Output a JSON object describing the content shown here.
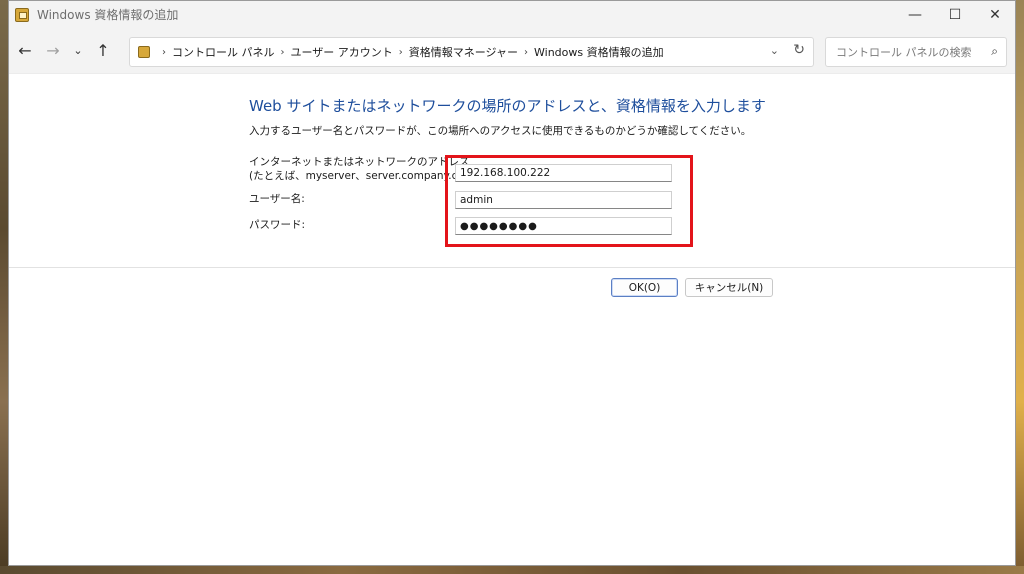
{
  "window": {
    "title": "Windows 資格情報の追加",
    "controls": {
      "minimize": "—",
      "maximize": "☐",
      "close": "✕"
    }
  },
  "nav": {
    "back": "←",
    "forward": "→",
    "recent": "⌄",
    "up": "↑",
    "breadcrumb": [
      "コントロール パネル",
      "ユーザー アカウント",
      "資格情報マネージャー",
      "Windows 資格情報の追加"
    ],
    "separator": "›",
    "dropdown": "⌄",
    "refresh": "↻",
    "search_placeholder": "コントロール パネルの検索",
    "search_icon": "⌕"
  },
  "form": {
    "heading": "Web サイトまたはネットワークの場所のアドレスと、資格情報を入力します",
    "description": "入力するユーザー名とパスワードが、この場所へのアクセスに使用できるものかどうか確認してください。",
    "address_label_line1": "インターネットまたはネットワークのアドレス",
    "address_label_line2": "(たとえば、myserver、server.company.com):",
    "address_value": "192.168.100.222",
    "username_label": "ユーザー名:",
    "username_value": "admin",
    "password_label": "パスワード:",
    "password_display": "●●●●●●●●"
  },
  "buttons": {
    "ok": "OK(O)",
    "cancel": "キャンセル(N)"
  },
  "colors": {
    "heading": "#1e4e9c",
    "highlight": "#e3141a"
  }
}
